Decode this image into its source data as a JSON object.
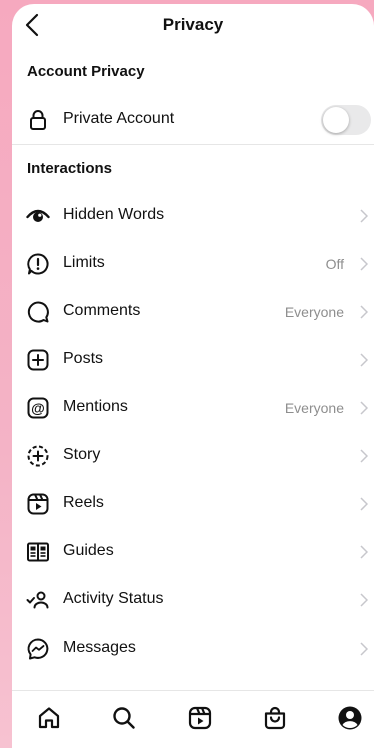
{
  "header": {
    "title": "Privacy",
    "back_icon": "chevron-left-icon"
  },
  "account_privacy": {
    "section_title": "Account Privacy",
    "private_account": {
      "label": "Private Account",
      "icon": "lock-icon",
      "enabled": false
    }
  },
  "interactions": {
    "section_title": "Interactions",
    "items": [
      {
        "label": "Hidden Words",
        "value": "",
        "icon": "eye-icon"
      },
      {
        "label": "Limits",
        "value": "Off",
        "icon": "alert-circle-icon"
      },
      {
        "label": "Comments",
        "value": "Everyone",
        "icon": "comment-icon"
      },
      {
        "label": "Posts",
        "value": "",
        "icon": "plus-square-icon"
      },
      {
        "label": "Mentions",
        "value": "Everyone",
        "icon": "at-sign-icon"
      },
      {
        "label": "Story",
        "value": "",
        "icon": "story-add-icon"
      },
      {
        "label": "Reels",
        "value": "",
        "icon": "reels-icon"
      },
      {
        "label": "Guides",
        "value": "",
        "icon": "guides-icon"
      },
      {
        "label": "Activity Status",
        "value": "",
        "icon": "activity-status-icon"
      },
      {
        "label": "Messages",
        "value": "",
        "icon": "messenger-icon"
      }
    ]
  },
  "tabbar": {
    "items": [
      {
        "name": "home",
        "icon": "home-icon"
      },
      {
        "name": "search",
        "icon": "search-icon"
      },
      {
        "name": "reels",
        "icon": "reels-icon"
      },
      {
        "name": "shop",
        "icon": "shopping-bag-icon"
      },
      {
        "name": "profile",
        "icon": "profile-icon"
      }
    ]
  }
}
